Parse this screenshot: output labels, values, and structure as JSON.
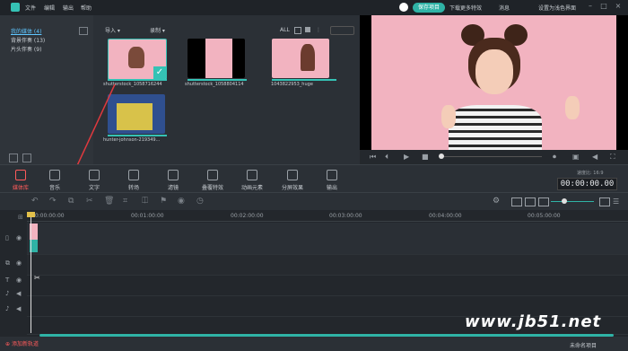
{
  "menu": [
    "文件",
    "编辑",
    "输出",
    "帮助"
  ],
  "topbar": {
    "save_label": "保存项目",
    "links": [
      "下载更多特效",
      "消息",
      "设置为浅色界面"
    ]
  },
  "library": {
    "items": [
      "我的媒体 (4)",
      "背景伴奏 (13)",
      "片头伴奏 (9)"
    ]
  },
  "media_header": {
    "import": "导入",
    "record": "录制",
    "all": "ALL"
  },
  "thumbs": [
    {
      "caption": "shutterstock_1058716244"
    },
    {
      "caption": "shutterstock_1058804114"
    },
    {
      "caption": "1043822953_huge"
    },
    {
      "caption": "hunter-johnson-219349..."
    }
  ],
  "toolbar": {
    "items": [
      "媒体库",
      "音乐",
      "文字",
      "转场",
      "滤镜",
      "叠覆特效",
      "动画元素",
      "分屏效果",
      "输出"
    ]
  },
  "timecode": {
    "label": "速度比: 16:9",
    "value": "00:00:00.00"
  },
  "ruler": [
    "00:00:00:00",
    "00:01:00:00",
    "00:02:00:00",
    "00:03:00:00",
    "00:04:00:00",
    "00:05:00:00"
  ],
  "bottom": {
    "add_track": "添加新轨道",
    "project_name": "未命名项目"
  },
  "watermark": "www.jb51.net",
  "colors": {
    "accent": "#2fb3a6",
    "active_tool": "#ff5b5b",
    "arrow": "#e0393e"
  }
}
